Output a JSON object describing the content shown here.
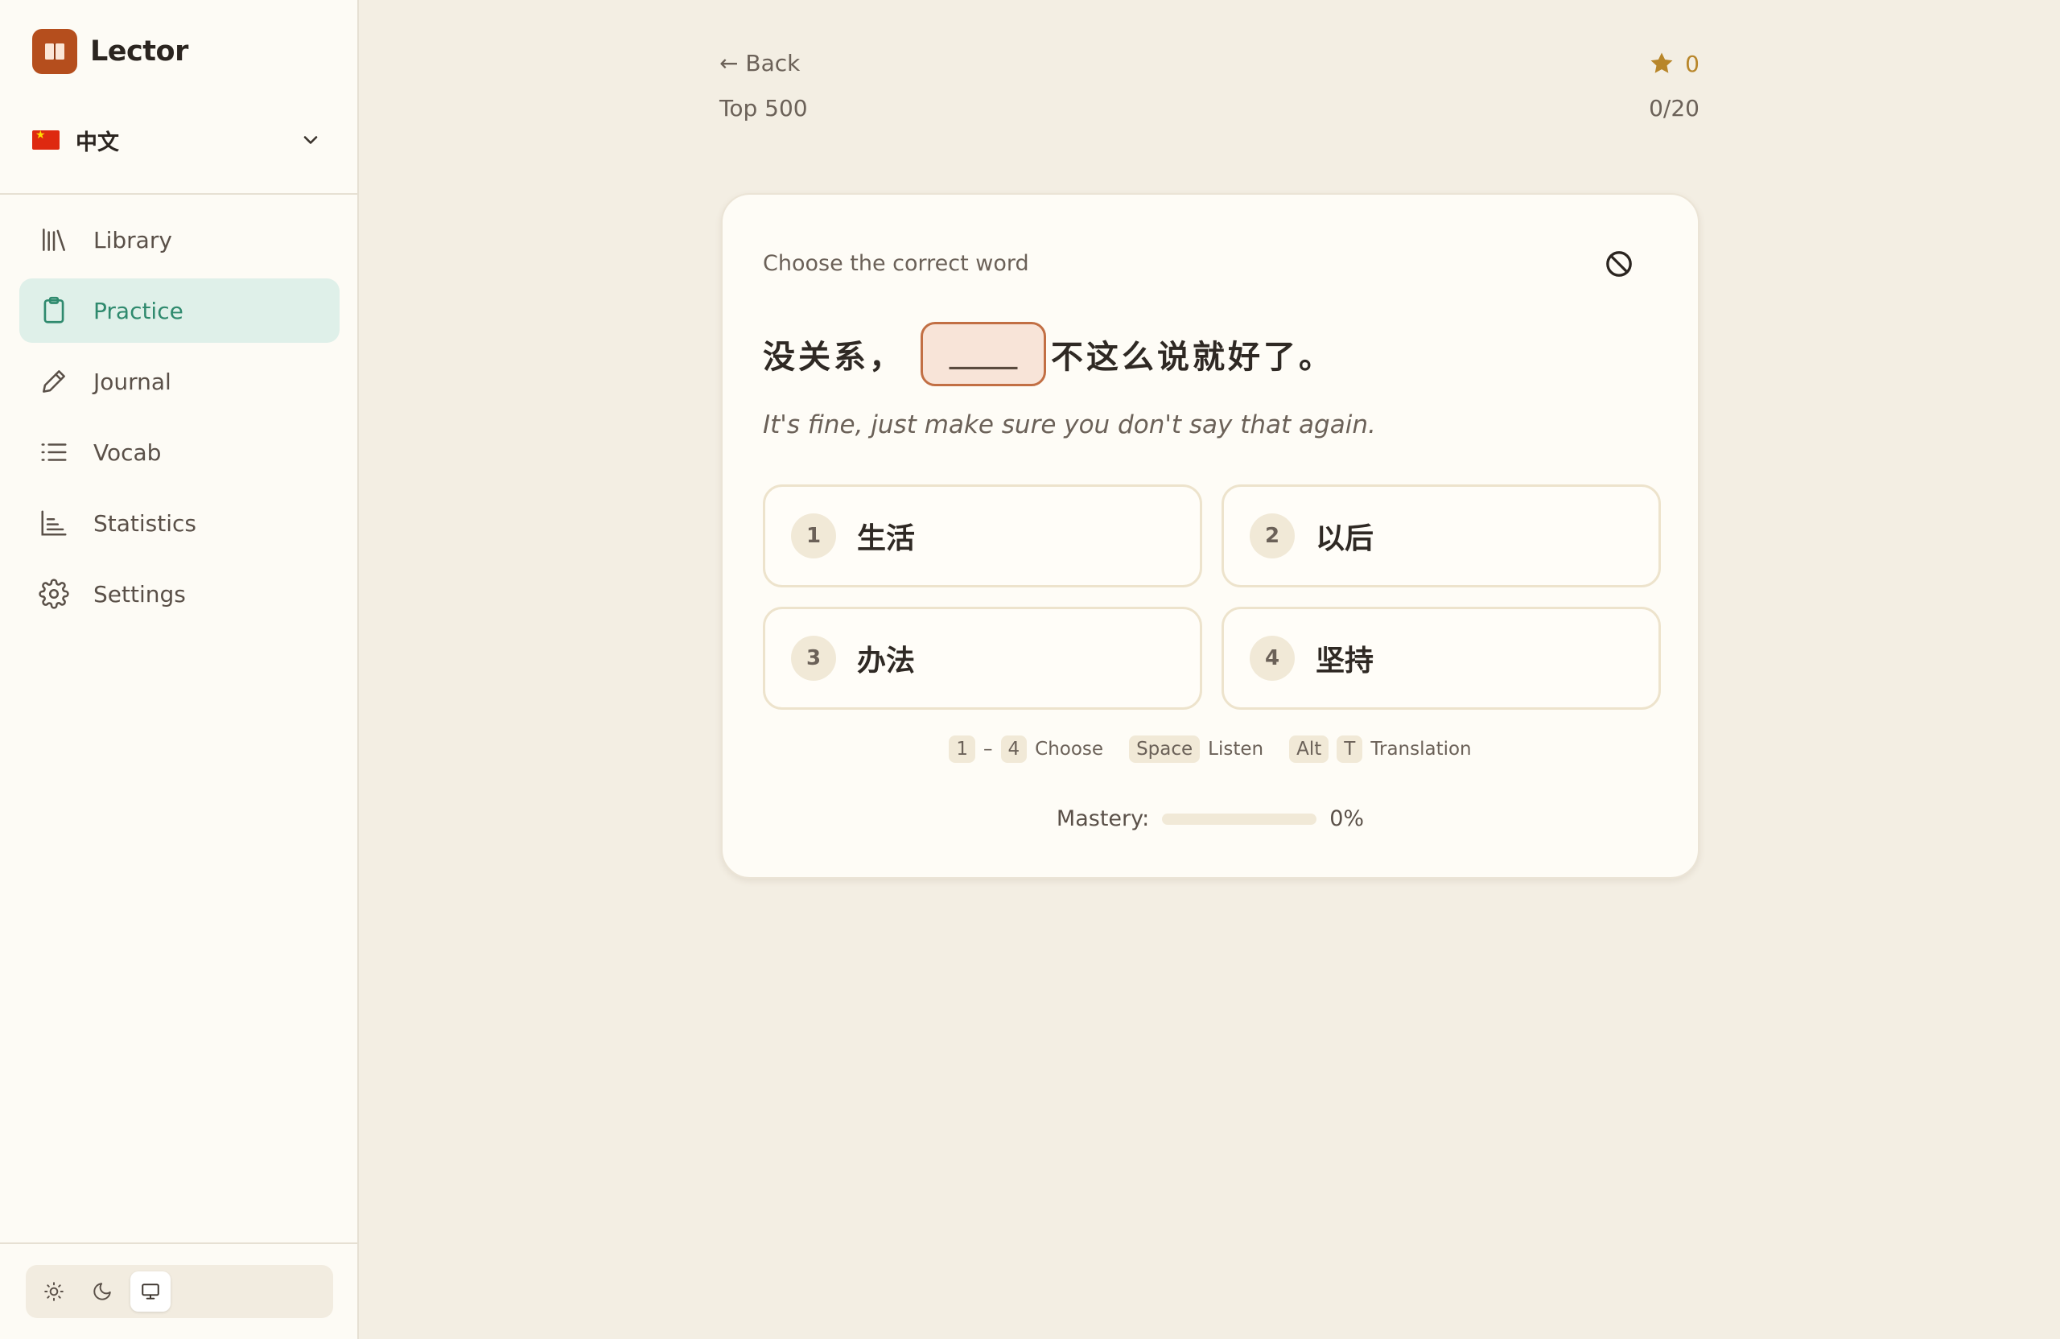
{
  "app": {
    "name": "Lector"
  },
  "language": {
    "label": "中文"
  },
  "nav": {
    "items": [
      {
        "label": "Library",
        "icon": "library-icon"
      },
      {
        "label": "Practice",
        "icon": "clipboard-icon",
        "active": true
      },
      {
        "label": "Journal",
        "icon": "pencil-icon"
      },
      {
        "label": "Vocab",
        "icon": "list-icon"
      },
      {
        "label": "Statistics",
        "icon": "bar-chart-icon"
      },
      {
        "label": "Settings",
        "icon": "gear-icon"
      }
    ]
  },
  "theme": {
    "options": [
      "light",
      "dark",
      "system"
    ],
    "selected": "system"
  },
  "header": {
    "back_label": "← Back",
    "deck_name": "Top 500",
    "stars": "0",
    "progress": "0/20"
  },
  "exercise": {
    "instruction": "Choose the correct word",
    "sentence_before": "没关系，",
    "blank": "_____",
    "sentence_after": "不这么说就好了。",
    "translation": "It's fine, just make sure you don't say that again.",
    "options": [
      {
        "num": "1",
        "text": "生活"
      },
      {
        "num": "2",
        "text": "以后"
      },
      {
        "num": "3",
        "text": "办法"
      },
      {
        "num": "4",
        "text": "坚持"
      }
    ]
  },
  "hints": {
    "key_first": "1",
    "dash": "–",
    "key_last": "4",
    "choose": "Choose",
    "key_space": "Space",
    "listen": "Listen",
    "key_alt": "Alt",
    "key_t": "T",
    "translation": "Translation"
  },
  "mastery": {
    "label": "Mastery:",
    "value_text": "0%",
    "value": 0
  },
  "colors": {
    "accent": "#2f8a6e",
    "brand": "#b54e1d",
    "blank_border": "#c26f44",
    "star": "#b8862a"
  }
}
